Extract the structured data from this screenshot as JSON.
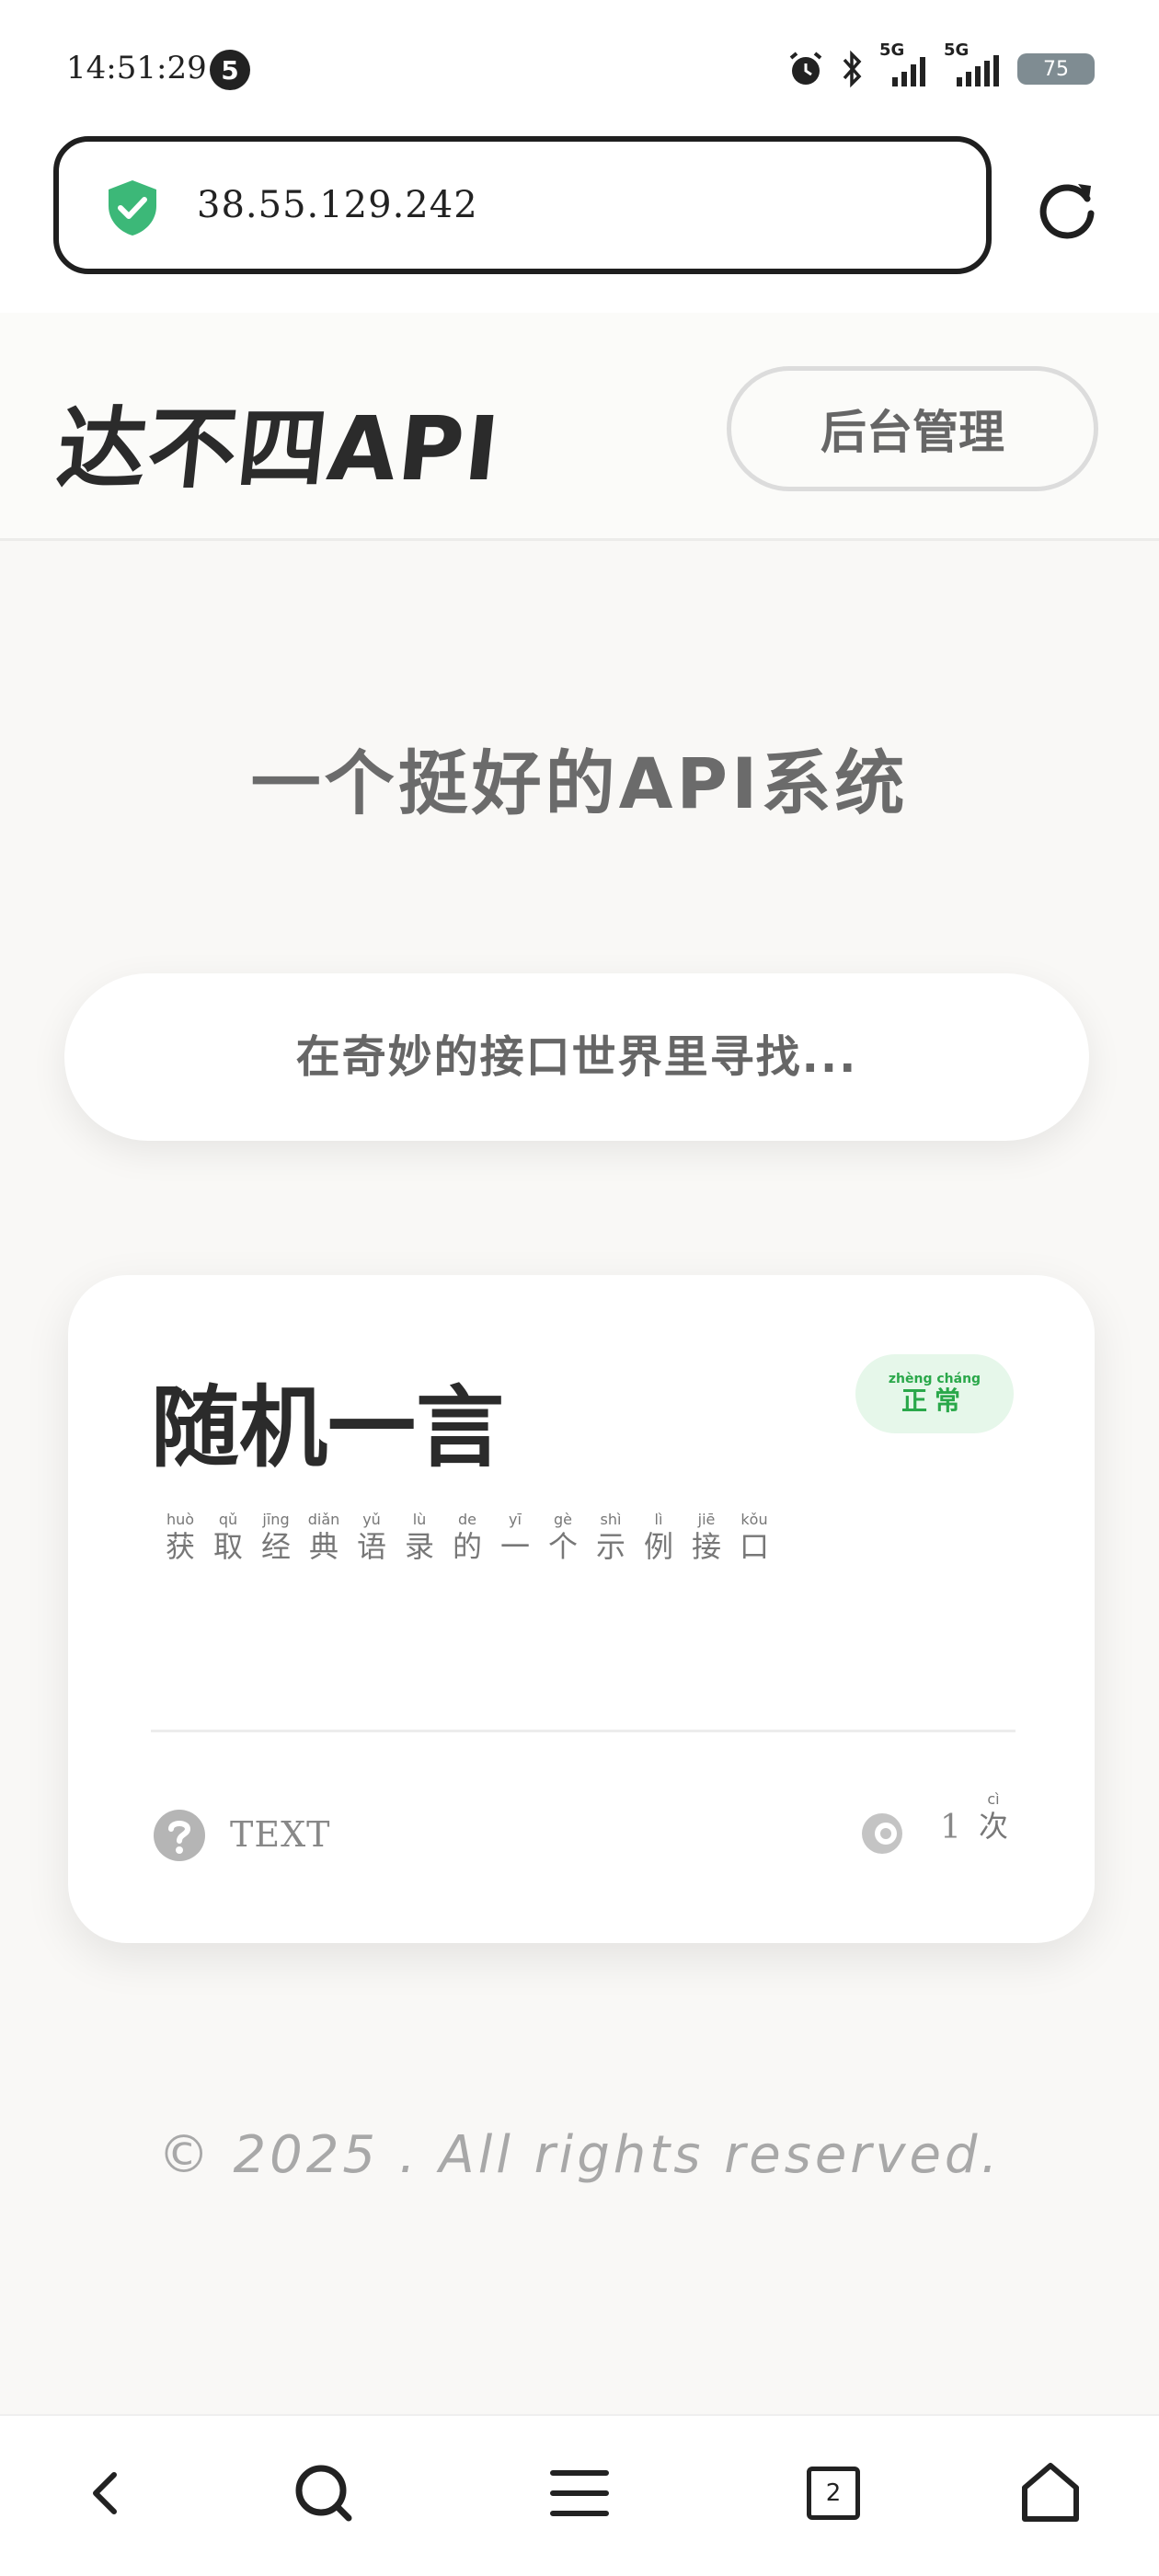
{
  "status_bar": {
    "time": "14:51:29",
    "notification_count": "5",
    "signal_1": "5G",
    "signal_2": "5G",
    "battery": "75"
  },
  "browser": {
    "url": "38.55.129.242"
  },
  "site": {
    "logo": "达不四API",
    "admin_button_label": "后台管理",
    "hero_title": "一个挺好的API系统",
    "search_placeholder": "在奇妙的接口世界里寻找..."
  },
  "api_card": {
    "title": "随机一言",
    "status": {
      "pinyin": "zhèng cháng",
      "text": "正常",
      "color": "#2aa84a"
    },
    "description": [
      {
        "py": "huò",
        "ch": "获"
      },
      {
        "py": "qǔ",
        "ch": "取"
      },
      {
        "py": "jīng",
        "ch": "经"
      },
      {
        "py": "diǎn",
        "ch": "典"
      },
      {
        "py": "yǔ",
        "ch": "语"
      },
      {
        "py": "lù",
        "ch": "录"
      },
      {
        "py": "de",
        "ch": "的"
      },
      {
        "py": "yī",
        "ch": "一"
      },
      {
        "py": "gè",
        "ch": "个"
      },
      {
        "py": "shì",
        "ch": "示"
      },
      {
        "py": "lì",
        "ch": "例"
      },
      {
        "py": "jiē",
        "ch": "接"
      },
      {
        "py": "kǒu",
        "ch": "口"
      }
    ],
    "type_label": "TEXT",
    "count": "1",
    "count_unit_pinyin": "cì",
    "count_unit": "次",
    "type_icon": "question-icon",
    "count_icon": "eye-icon"
  },
  "footer": {
    "copyright": "© 2025 . All rights reserved."
  },
  "bottom_nav": {
    "tab_count": "2",
    "icons": [
      "back-icon",
      "search-icon",
      "menu-icon",
      "tabs-icon",
      "home-icon"
    ]
  },
  "colors": {
    "accent_green": "#3cb878",
    "background": "#f9f8f6"
  }
}
